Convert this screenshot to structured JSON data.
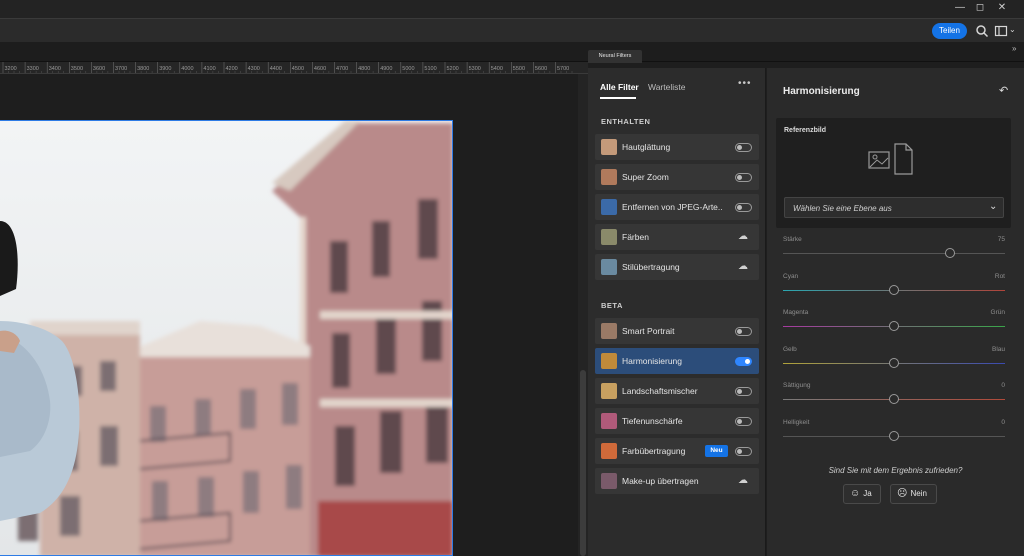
{
  "window": {
    "minimize": "—",
    "maximize": "◻",
    "close": "✕"
  },
  "toolbar": {
    "share_label": "Teilen"
  },
  "tabs": {
    "neural_filters": "Neural Filters"
  },
  "ruler": {
    "ticks": [
      "3200",
      "3300",
      "3400",
      "3500",
      "3600",
      "3700",
      "3800",
      "3900",
      "4000",
      "4100",
      "4200",
      "4300",
      "4400",
      "4500",
      "4600",
      "4700",
      "4800",
      "4900",
      "5000",
      "5100",
      "5200",
      "5300",
      "5400",
      "5500",
      "5600",
      "5700"
    ]
  },
  "filter_panel": {
    "tab_all": "Alle Filter",
    "tab_wait": "Warteliste",
    "more": "•••",
    "section_included": "ENTHALTEN",
    "section_beta": "BETA",
    "included": [
      {
        "label": "Hautglättung",
        "control": "toggle",
        "on": false,
        "thumb": "#c49a7a"
      },
      {
        "label": "Super Zoom",
        "control": "toggle",
        "on": false,
        "thumb": "#b07a5c"
      },
      {
        "label": "Entfernen von JPEG-Arte...",
        "control": "toggle",
        "on": false,
        "thumb": "#3b6aa8"
      },
      {
        "label": "Färben",
        "control": "cloud",
        "thumb": "#8a8a6a"
      },
      {
        "label": "Stilübertragung",
        "control": "cloud",
        "thumb": "#6a8aa0"
      }
    ],
    "beta": [
      {
        "label": "Smart Portrait",
        "control": "toggle",
        "on": false,
        "thumb": "#9a7a66"
      },
      {
        "label": "Harmonisierung",
        "control": "toggle",
        "on": true,
        "selected": true,
        "thumb": "#c08a3a"
      },
      {
        "label": "Landschaftsmischer",
        "control": "toggle",
        "on": false,
        "thumb": "#c8a060"
      },
      {
        "label": "Tiefenunschärfe",
        "control": "toggle",
        "on": false,
        "thumb": "#b05a7a"
      },
      {
        "label": "Farbübertragung",
        "control": "toggle",
        "on": false,
        "badge": "Neu",
        "thumb": "#d06a3a"
      },
      {
        "label": "Make-up übertragen",
        "control": "cloud",
        "thumb": "#7a5a6a"
      }
    ]
  },
  "settings": {
    "title": "Harmonisierung",
    "reference_title": "Referenzbild",
    "layer_placeholder": "Wählen Sie eine Ebene aus",
    "sliders": [
      {
        "left": "Stärke",
        "right": "75",
        "value": 0.75,
        "gradient": ""
      },
      {
        "left": "Cyan",
        "right": "Rot",
        "value": 0.5,
        "gradient": "linear-gradient(90deg,#2aa6b0,#b0443a)"
      },
      {
        "left": "Magenta",
        "right": "Grün",
        "value": 0.5,
        "gradient": "linear-gradient(90deg,#a63aa0,#3aa64a)"
      },
      {
        "left": "Gelb",
        "right": "Blau",
        "value": 0.5,
        "gradient": "linear-gradient(90deg,#b0a23a,#3a4ab0)"
      },
      {
        "left": "Sättigung",
        "right": "0",
        "value": 0.5,
        "gradient": "linear-gradient(90deg,#7a7a7a,#b04a3a)"
      },
      {
        "left": "Helligkeit",
        "right": "0",
        "value": 0.5,
        "gradient": ""
      }
    ],
    "feedback_question": "Sind Sie mit dem Ergebnis zufrieden?",
    "yes_label": "Ja",
    "no_label": "Nein"
  }
}
